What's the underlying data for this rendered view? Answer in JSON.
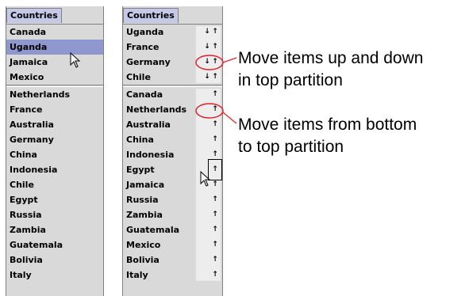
{
  "left": {
    "tab": "Countries",
    "top_items": [
      "Canada",
      "Uganda",
      "Jamaica",
      "Mexico"
    ],
    "selected_index": 1,
    "bottom_items": [
      "Netherlands",
      "France",
      "Australia",
      "Germany",
      "China",
      "Indonesia",
      "Chile",
      "Egypt",
      "Russia",
      "Zambia",
      "Guatemala",
      "Bolivia",
      "Italy"
    ]
  },
  "right": {
    "tab": "Countries",
    "top_items": [
      "Uganda",
      "France",
      "Germany",
      "Chile"
    ],
    "bottom_items": [
      "Canada",
      "Netherlands",
      "Australia",
      "China",
      "Indonesia",
      "Egypt",
      "Jamaica",
      "Russia",
      "Zambia",
      "Guatemala",
      "Mexico",
      "Bolivia",
      "Italy"
    ],
    "down_glyph": "↓",
    "up_glyph": "↑"
  },
  "annotations": {
    "top_line1": "Move items up and down",
    "top_line2": "in top partition",
    "bottom_line1": "Move items from bottom",
    "bottom_line2": "to top partition"
  },
  "colors": {
    "tab": "#c5c9e7",
    "selection": "#8f97cf",
    "highlight_circle": "#e0202a"
  }
}
